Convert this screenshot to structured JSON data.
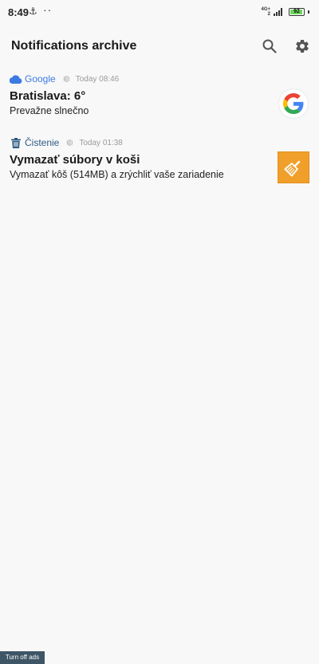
{
  "status_bar": {
    "time": "8:49",
    "anchor_glyph": "⚓",
    "dots": "··",
    "network_label_top": "4G+",
    "network_label_bottom": "2",
    "battery_level": 92,
    "battery_text": "92",
    "battery_color": "#6ad85a"
  },
  "header": {
    "title": "Notifications archive",
    "search_icon": "search-icon",
    "settings_icon": "gear-icon"
  },
  "notifications": [
    {
      "app_icon": "cloud-icon",
      "app_name": "Google",
      "app_color": "#3d7be0",
      "time": "Today 08:46",
      "title": "Bratislava: 6°",
      "text": "Prevažne slnečno",
      "thumb_icon": "google-logo-icon"
    },
    {
      "app_icon": "trash-icon",
      "app_name": "Čistenie",
      "app_color": "#2e5b83",
      "time": "Today 01:38",
      "title": "Vymazať súbory v koši",
      "text": "Vymazať kôš (514MB) a zrýchliť vaše zariadenie",
      "thumb_icon": "broom-icon",
      "thumb_color": "#f0a02a"
    }
  ],
  "footer": {
    "ads_label": "Turn off ads"
  }
}
